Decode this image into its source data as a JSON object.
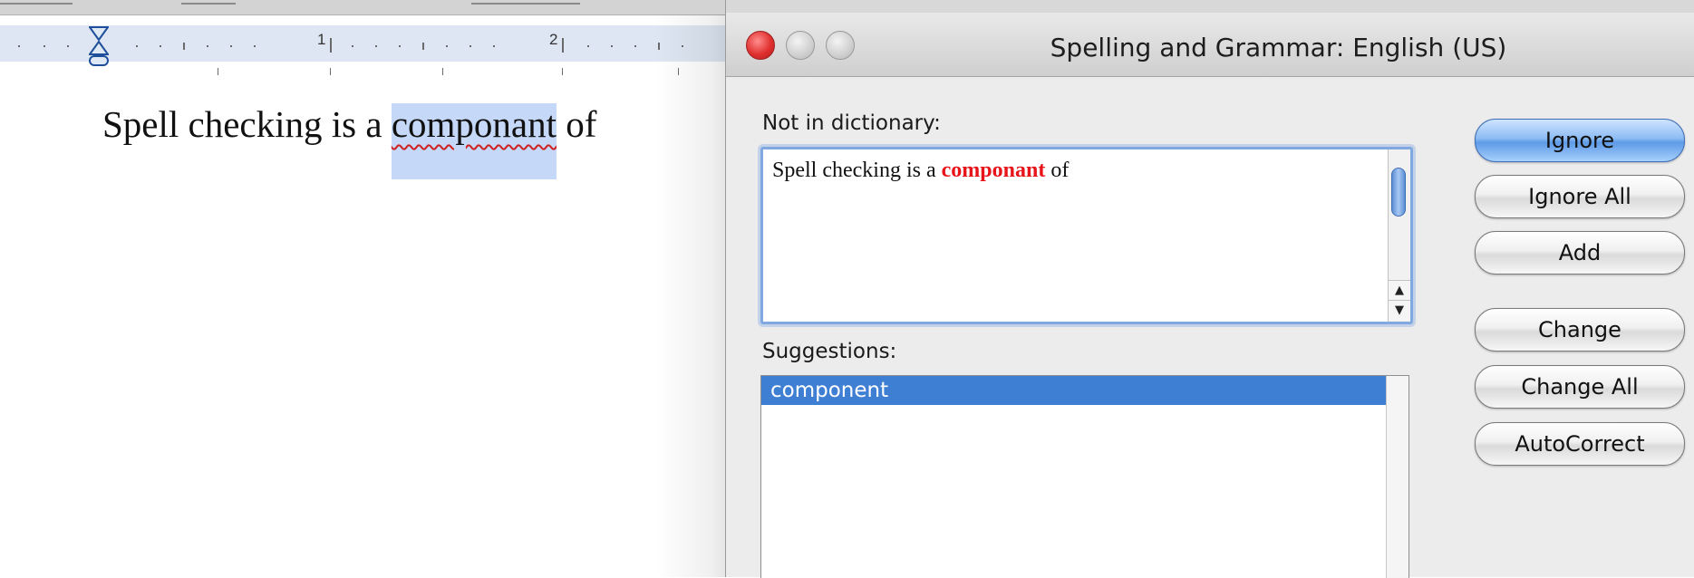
{
  "document": {
    "ruler": {
      "marks": [
        "1",
        "2"
      ]
    },
    "text_before": "Spell checking is a ",
    "misspelled_word": "componant",
    "text_after": " of"
  },
  "dialog": {
    "title": "Spelling and Grammar: English (US)",
    "not_in_dictionary_label": "Not in dictionary:",
    "context": {
      "before": "Spell checking is a ",
      "flagged": "componant",
      "after": " of"
    },
    "suggestions_label": "Suggestions:",
    "suggestions": [
      "component"
    ],
    "selected_suggestion": "component",
    "buttons": {
      "ignore": "Ignore",
      "ignore_all": "Ignore All",
      "add": "Add",
      "change": "Change",
      "change_all": "Change All",
      "autocorrect": "AutoCorrect"
    }
  },
  "colors": {
    "flagged_word": "#e8141a",
    "selection_highlight": "#c5d8f7",
    "selected_suggestion_row": "#3f7fd3",
    "default_button": "#5e9ae7"
  }
}
